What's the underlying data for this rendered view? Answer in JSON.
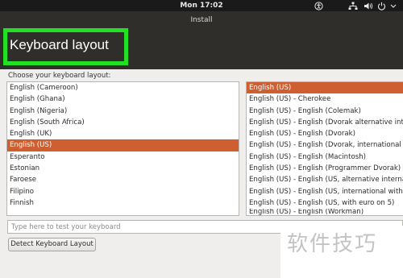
{
  "top_bar": {
    "clock": "Mon 17:02",
    "icons": [
      "accessibility-icon",
      "network-icon",
      "volume-icon",
      "power-icon",
      "chevron-down-icon"
    ]
  },
  "window": {
    "title": "Install"
  },
  "header": {
    "title": "Keyboard layout",
    "highlight_color": "#22e022"
  },
  "prompt": "Choose your keyboard layout:",
  "layouts": [
    {
      "label": "English (Cameroon)"
    },
    {
      "label": "English (Ghana)"
    },
    {
      "label": "English (Nigeria)"
    },
    {
      "label": "English (South Africa)"
    },
    {
      "label": "English (UK)"
    },
    {
      "label": "English (US)",
      "selected": true
    },
    {
      "label": "Esperanto"
    },
    {
      "label": "Estonian"
    },
    {
      "label": "Faroese"
    },
    {
      "label": "Filipino"
    },
    {
      "label": "Finnish"
    }
  ],
  "variants": [
    {
      "label": "English (US)",
      "selected": true
    },
    {
      "label": "English (US) - Cherokee"
    },
    {
      "label": "English (US) - English (Colemak)"
    },
    {
      "label": "English (US) - English (Dvorak alternative international no dead keys)"
    },
    {
      "label": "English (US) - English (Dvorak)"
    },
    {
      "label": "English (US) - English (Dvorak, international with dead keys)"
    },
    {
      "label": "English (US) - English (Macintosh)"
    },
    {
      "label": "English (US) - English (Programmer Dvorak)"
    },
    {
      "label": "English (US) - English (US, alternative international)"
    },
    {
      "label": "English (US) - English (US, international with dead keys)"
    },
    {
      "label": "English (US) - English (US, with euro on 5)"
    },
    {
      "label": "English (US) - English (Workman)",
      "partial": true
    }
  ],
  "test_input": {
    "placeholder": "Type here to test your keyboard",
    "value": ""
  },
  "detect_button": "Detect Keyboard Layout",
  "watermark": "软件技巧",
  "colors": {
    "selection": "#cd5f31",
    "header_bg": "#2f2e2b",
    "top_bar_bg": "#1a1a1a"
  }
}
